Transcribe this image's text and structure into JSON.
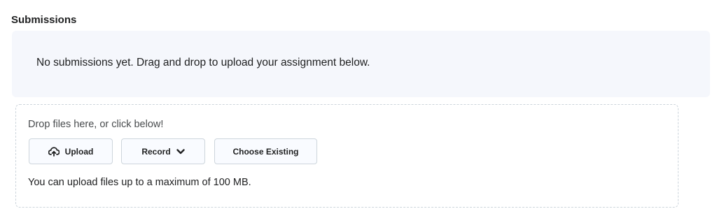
{
  "section": {
    "title": "Submissions",
    "empty_message": "No submissions yet. Drag and drop to upload your assignment below."
  },
  "dropzone": {
    "prompt": "Drop files here, or click below!",
    "buttons": {
      "upload_label": "Upload",
      "upload_icon": "cloud-upload-icon",
      "record_label": "Record",
      "record_icon": "chevron-down-icon",
      "choose_existing_label": "Choose Existing"
    },
    "size_limit": "You can upload files up to a maximum of 100 MB."
  }
}
